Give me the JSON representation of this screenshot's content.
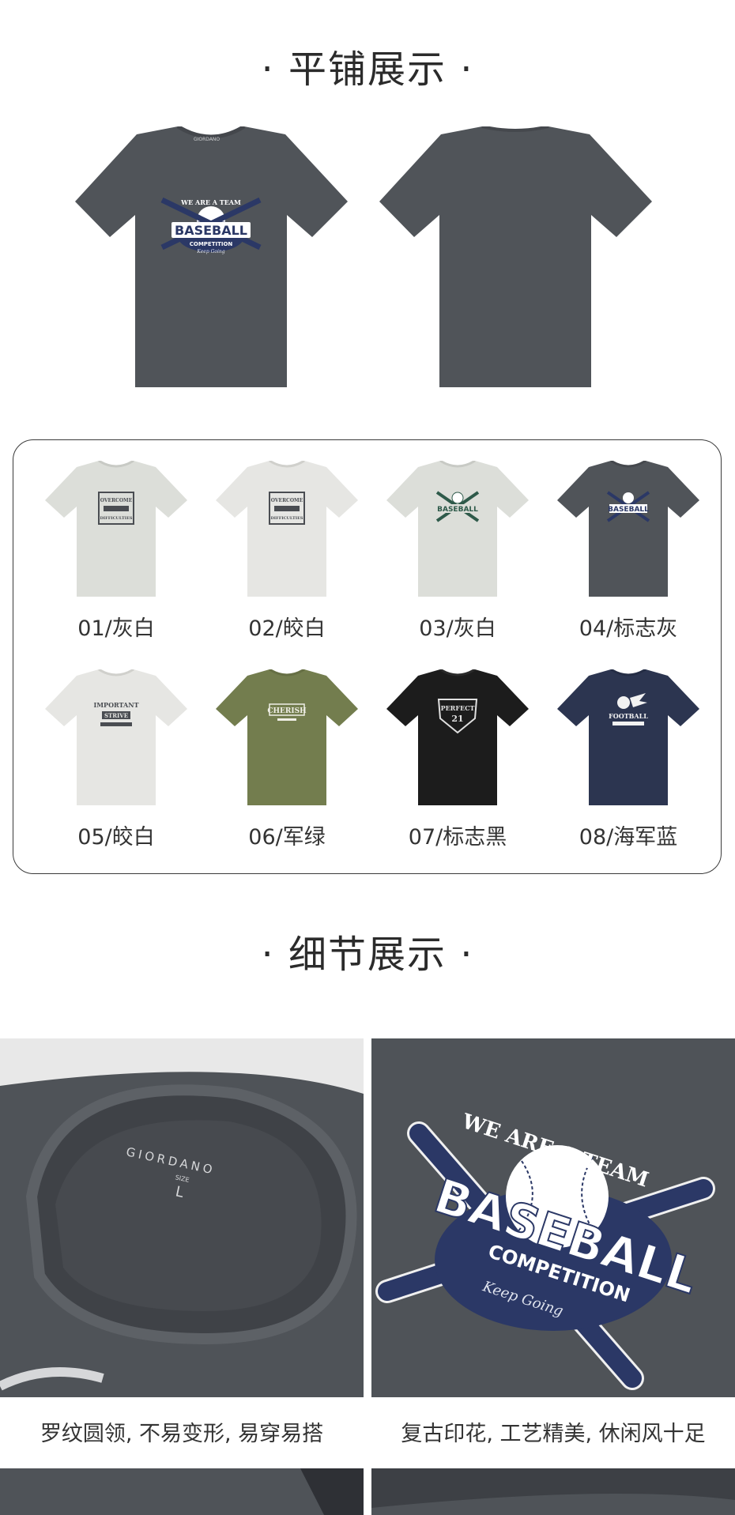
{
  "section_flat": {
    "title": "· 平铺展示 ·"
  },
  "hero": {
    "front_print": {
      "arc_text": "WE ARE A TEAM",
      "main": "BASEBALL",
      "sub": "COMPETITION",
      "script": "Keep Going"
    },
    "shirt_color": "#505459"
  },
  "swatches": [
    {
      "label": "01/灰白",
      "color": "#dcded9",
      "print_color": "#4a4d52",
      "print": "OVERCOME DIFFICULTIES"
    },
    {
      "label": "02/皎白",
      "color": "#e6e6e3",
      "print_color": "#4a4d52",
      "print": "OVERCOME DIFFICULTIES"
    },
    {
      "label": "03/灰白",
      "color": "#dcded9",
      "print_color": "#2e5a4a",
      "print": "BASEBALL"
    },
    {
      "label": "04/标志灰",
      "color": "#505459",
      "print_color": "#e8e8e8",
      "print": "BASEBALL"
    },
    {
      "label": "05/皎白",
      "color": "#e6e6e3",
      "print_color": "#4a4d52",
      "print": "IMPORTANT STRIVE"
    },
    {
      "label": "06/军绿",
      "color": "#737d4e",
      "print_color": "#f0efe6",
      "print": "CHERISH"
    },
    {
      "label": "07/标志黑",
      "color": "#1c1c1c",
      "print_color": "#e0e0e0",
      "print": "PERFECT 21"
    },
    {
      "label": "08/海军蓝",
      "color": "#2c3550",
      "print_color": "#f2f2f2",
      "print": "FOOTBALL"
    }
  ],
  "section_detail": {
    "title": "· 细节展示 ·"
  },
  "details": {
    "left": {
      "brand": "GIORDANO",
      "size_word": "SIZE",
      "size": "L",
      "caption": "罗纹圆领, 不易变形, 易穿易搭"
    },
    "right": {
      "arc_text": "WE ARE A TEAM",
      "main": "BASEBALL",
      "sub": "COMPETITION",
      "script": "Keep Going",
      "caption": "复古印花, 工艺精美, 休闲风十足"
    }
  },
  "colors": {
    "navy_print": "#2b3866",
    "shirt_gray": "#505459",
    "text": "#2b2b2b"
  }
}
